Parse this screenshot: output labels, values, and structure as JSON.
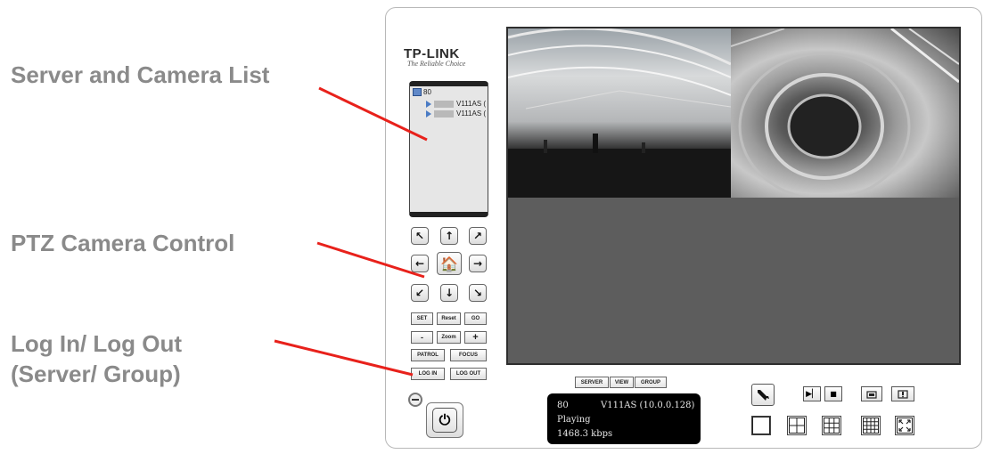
{
  "annotations": {
    "server_camera_list": "Server and Camera List",
    "ptz_control": "PTZ Camera Control",
    "login_line1": "Log In/ Log Out",
    "login_line2": "(Server/ Group)"
  },
  "annotation_line_color": "#e8211b",
  "logo": {
    "brand": "TP-LINK",
    "tagline": "The Reliable Choice"
  },
  "camera_list": {
    "root_label": "80",
    "items": [
      {
        "label": "V111AS ("
      },
      {
        "label": "V111AS ("
      }
    ]
  },
  "ptz": {
    "up_left": "↖",
    "up": "↑",
    "up_right": "↗",
    "left": "←",
    "home": "🏠",
    "right": "→",
    "down_left": "↙",
    "down": "↓",
    "down_right": "↘",
    "set": "SET",
    "reset": "Reset",
    "go": "GO",
    "zoom_out": "-",
    "zoom": "Zoom",
    "zoom_in": "+",
    "patrol": "PATROL",
    "focus": "FOCUS",
    "login": "LOG IN",
    "logout": "LOG OUT"
  },
  "power_symbol": "⏻",
  "view_tabs": {
    "server": "SERVER",
    "view": "VIEW",
    "group": "GROUP"
  },
  "status": {
    "server_id": "80",
    "camera": "V111AS (10.0.0.128)",
    "state": "Playing",
    "bitrate": "1468.3 kbps"
  },
  "controls": {
    "play": "▶▏",
    "stop": "■",
    "settings_icon": "wrench-icon"
  }
}
